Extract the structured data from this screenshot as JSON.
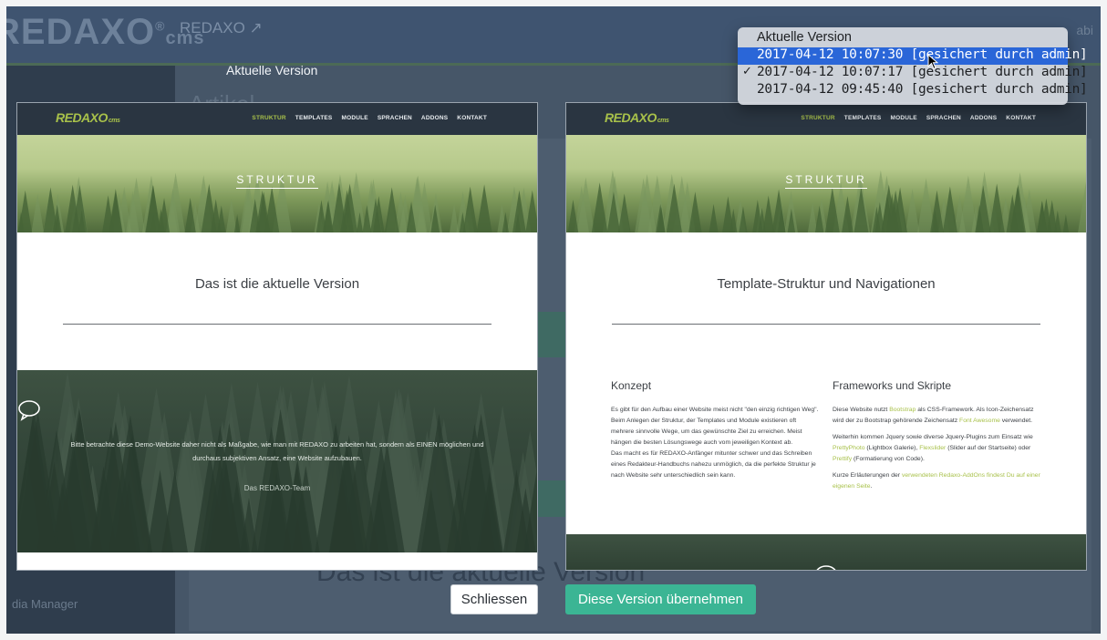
{
  "backend": {
    "logo": "REDAXO",
    "logo_suffix": "cms",
    "site_name": "REDAXO",
    "header_right": "abi",
    "page_heading": "Artikel",
    "sidebar_media": "dia Manager",
    "bottom_text": "Das ist die aktuelle Version"
  },
  "compare": {
    "left_label": "Aktuelle Version"
  },
  "preview_left": {
    "logo": "REDAXO",
    "logo_suffix": "cms",
    "menu": [
      "STRUKTUR",
      "TEMPLATES",
      "MODULE",
      "SPRACHEN",
      "ADDONS",
      "KONTAKT"
    ],
    "hero_title": "STRUKTUR",
    "section_title": "Das ist die aktuelle Version",
    "forest_text": "Bitte betrachte diese Demo-Website daher nicht als Maßgabe, wie man mit REDAXO zu arbeiten hat, sondern als EINEN möglichen und durchaus subjektiven Ansatz, eine Website aufzubauen.",
    "forest_team": "Das REDAXO-Team"
  },
  "preview_right": {
    "logo": "REDAXO",
    "logo_suffix": "cms",
    "menu": [
      "STRUKTUR",
      "TEMPLATES",
      "MODULE",
      "SPRACHEN",
      "ADDONS",
      "KONTAKT"
    ],
    "hero_title": "STRUKTUR",
    "section_title": "Template-Struktur und Navigationen",
    "col1_title": "Konzept",
    "col1_p1": "Es gibt für den Aufbau einer Website meist nicht \"den einzig richtigen Weg\". Beim Anlegen der Struktur, der Templates und Module existieren oft mehrere sinnvolle Wege, um das gewünschte Ziel zu erreichen. Meist hängen die besten Lösungswege auch vom jeweiligen Kontext ab.",
    "col1_p2": "Das macht es für REDAXO-Anfänger mitunter schwer und das Schreiben eines Redakteur-Handbuchs nahezu unmöglich, da die perfekte Struktur je nach Website sehr unterschiedlich sein kann.",
    "col2_title": "Frameworks und Skripte",
    "col2_p1_a": "Diese Website nutzt ",
    "col2_p1_link1": "Bootstrap",
    "col2_p1_b": " als CSS-Framework. Als Icon-Zeichensatz wird der zu Bootstrap gehörende Zeichensatz ",
    "col2_p1_link2": "Font Awesome",
    "col2_p1_c": " verwendet.",
    "col2_p2_a": "Weiterhin kommen Jquery sowie diverse Jquery-Plugins zum Einsatz wie ",
    "col2_p2_link1": "PrettyPhoto",
    "col2_p2_b": " (Lightbox Galerie), ",
    "col2_p2_link2": "Flexslider",
    "col2_p2_c": " (Slider auf der Startseite) oder ",
    "col2_p2_link3": "Prettify",
    "col2_p2_d": " (Formatierung von Code).",
    "col2_p3_a": "Kurze Erläuterungen der ",
    "col2_p3_link": "verwendeten Redaxo-AddOns findest Du auf einer eigenen Seite",
    "col2_p3_b": "."
  },
  "buttons": {
    "close": "Schliessen",
    "apply": "Diese Version übernehmen"
  },
  "dropdown": {
    "header": "Aktuelle Version",
    "items": [
      {
        "label": "2017-04-12 10:07:30 [gesichert durch admin]",
        "highlighted": true,
        "checked": false
      },
      {
        "label": "2017-04-12 10:07:17 [gesichert durch admin]",
        "highlighted": false,
        "checked": true
      },
      {
        "label": "2017-04-12 09:45:40 [gesichert durch admin]",
        "highlighted": false,
        "checked": false
      }
    ],
    "check_mark": "✓"
  },
  "colors": {
    "accent_green": "#a8c14a",
    "apply_button": "#3bb594",
    "selection_blue": "#2a66d8"
  }
}
